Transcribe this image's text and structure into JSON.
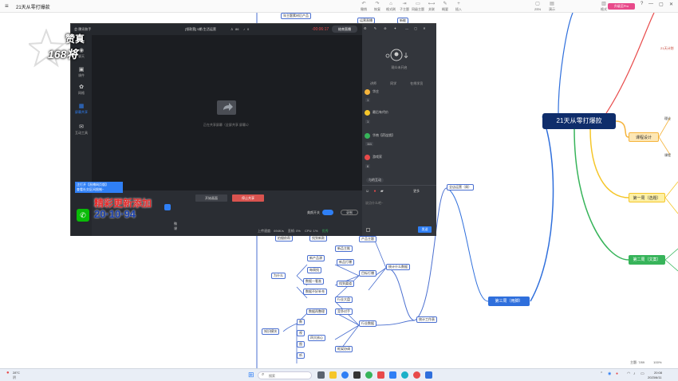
{
  "app": {
    "menu_glyph": "≡",
    "doc_title": "21天从零打爆款",
    "toolbar_mid": [
      {
        "glyph": "↶",
        "label": "撤销"
      },
      {
        "glyph": "↷",
        "label": "恢复"
      },
      {
        "glyph": "⌂",
        "label": "格式刷"
      },
      {
        "glyph": "⇥",
        "label": "子主题"
      },
      {
        "glyph": "▭",
        "label": "同级主题"
      },
      {
        "glyph": "⟷",
        "label": "关联"
      },
      {
        "glyph": "✎",
        "label": "概要"
      },
      {
        "glyph": "+",
        "label": "插入"
      }
    ],
    "toolbar_right": [
      {
        "glyph": "▢",
        "label": "ZEN"
      },
      {
        "glyph": "▤",
        "label": "演示"
      },
      {
        "glyph": "▥",
        "label": "格式"
      }
    ],
    "pro_button": "升级至Pro",
    "window_controls": [
      "?",
      "—",
      "▢",
      "✕"
    ],
    "status": {
      "topics": "主题: 7/89",
      "zoom": "100%"
    }
  },
  "mindmap": {
    "root": "21天从零打爆款",
    "branches": [
      {
        "label": "课程设计",
        "color": "#f5b43c",
        "bg": "#fde7b5"
      },
      {
        "label": "第一周（选题）",
        "color": "#f5c62a",
        "bg": "#fdf0a5"
      },
      {
        "label": "第二周（文案）",
        "color": "#37b45a",
        "bg": "#37b45a"
      },
      {
        "label": "第三周（用脚）",
        "color": "#2f6fdc",
        "bg": "#2f6fdc"
      }
    ],
    "right_edge": [
      "21天计划",
      "理论",
      "课程"
    ],
    "sub_nodes": {
      "top_1": "年主题素材后产品",
      "top_2": "运营直播",
      "top_3": "新能",
      "week3_child": "全店运营（周）",
      "stat": "统计什么数据",
      "tool": "统计工作表",
      "why": "为什么",
      "goal": "目标打爆",
      "product_a": "产品主题",
      "product_b": "新品主推",
      "d1": "找到新款",
      "d2": "找到渠道",
      "d3": "新产品源",
      "d4": "新品打爆",
      "d5": "数据一看准",
      "d6": "数据不好补充",
      "a1": "找到新款",
      "a2": "每周找",
      "a3": "规划建议",
      "a4": "行业大盘",
      "a5": "竞争对手",
      "a6": "行业数据",
      "a7": "搭建流程",
      "a8": "数据再整理",
      "a9": "四大核心",
      "a10": "框架协调",
      "left_1": "拍摄前帮",
      "left_2": "内容分析",
      "left_3": "知识模块",
      "i1": "数",
      "i2": "视",
      "i3": "图",
      "i4": "听"
    }
  },
  "recorder": {
    "app_title": "会·腾讯和手",
    "meeting_title": "[领款营] 5期-生活运营",
    "participants": "86",
    "mic_count": "0",
    "timer": "-00:06:17",
    "end_button": "结束直播",
    "sidebar": [
      {
        "glyph": "◉",
        "label": "聊天"
      },
      {
        "glyph": "▣",
        "label": "课件"
      },
      {
        "glyph": "✿",
        "label": "网格"
      },
      {
        "glyph": "▦",
        "label": "屏幕共享"
      },
      {
        "glyph": "✉",
        "label": "互动工具"
      }
    ],
    "share_hint": "正在共享屏幕（全屏共享 屏幕1）",
    "start_btn": "开始画面",
    "stop_btn": "停止共享",
    "auto_label": "美颜开关",
    "auto_button": "录制",
    "status_bar": {
      "upload": "上传速度:",
      "upload_val": "694K/s",
      "loss": "丢帧:",
      "loss_val": "0%",
      "cpu": "CPU:",
      "cpu_val": "1%",
      "quality": "优秀"
    },
    "right_panel": {
      "title": "观众未开启",
      "tabs": [
        "讲师",
        "同学",
        "在线学员"
      ],
      "msgs": [
        {
          "name": "华庄",
          "color": "#f5b43c",
          "text": "1"
        },
        {
          "name": "最后有代价",
          "color": "#f5c62a",
          "text": "1"
        },
        {
          "name": "华南【药连锁】",
          "color": "#37b45a",
          "text": "111"
        },
        {
          "name": "游戏家",
          "color": "#e84a4a",
          "text": "6"
        }
      ],
      "chat_label": "与的互动",
      "chat_placeholder": "说点什么吧~",
      "send": "发送",
      "more": "更多"
    }
  },
  "banner": {
    "notice_1": "注打开【直播网页版】",
    "notice_2": "查看社交区间限制~",
    "big_text": "精彩更新添加",
    "number": "20·10·94",
    "small": "微课"
  },
  "stamp": {
    "line1": "赞真",
    "line2": "168将"
  },
  "taskbar": {
    "weather_temp": "28°C",
    "weather_text": "阴",
    "search": "搜索",
    "time": "20:08",
    "date": "2023/6/11"
  }
}
